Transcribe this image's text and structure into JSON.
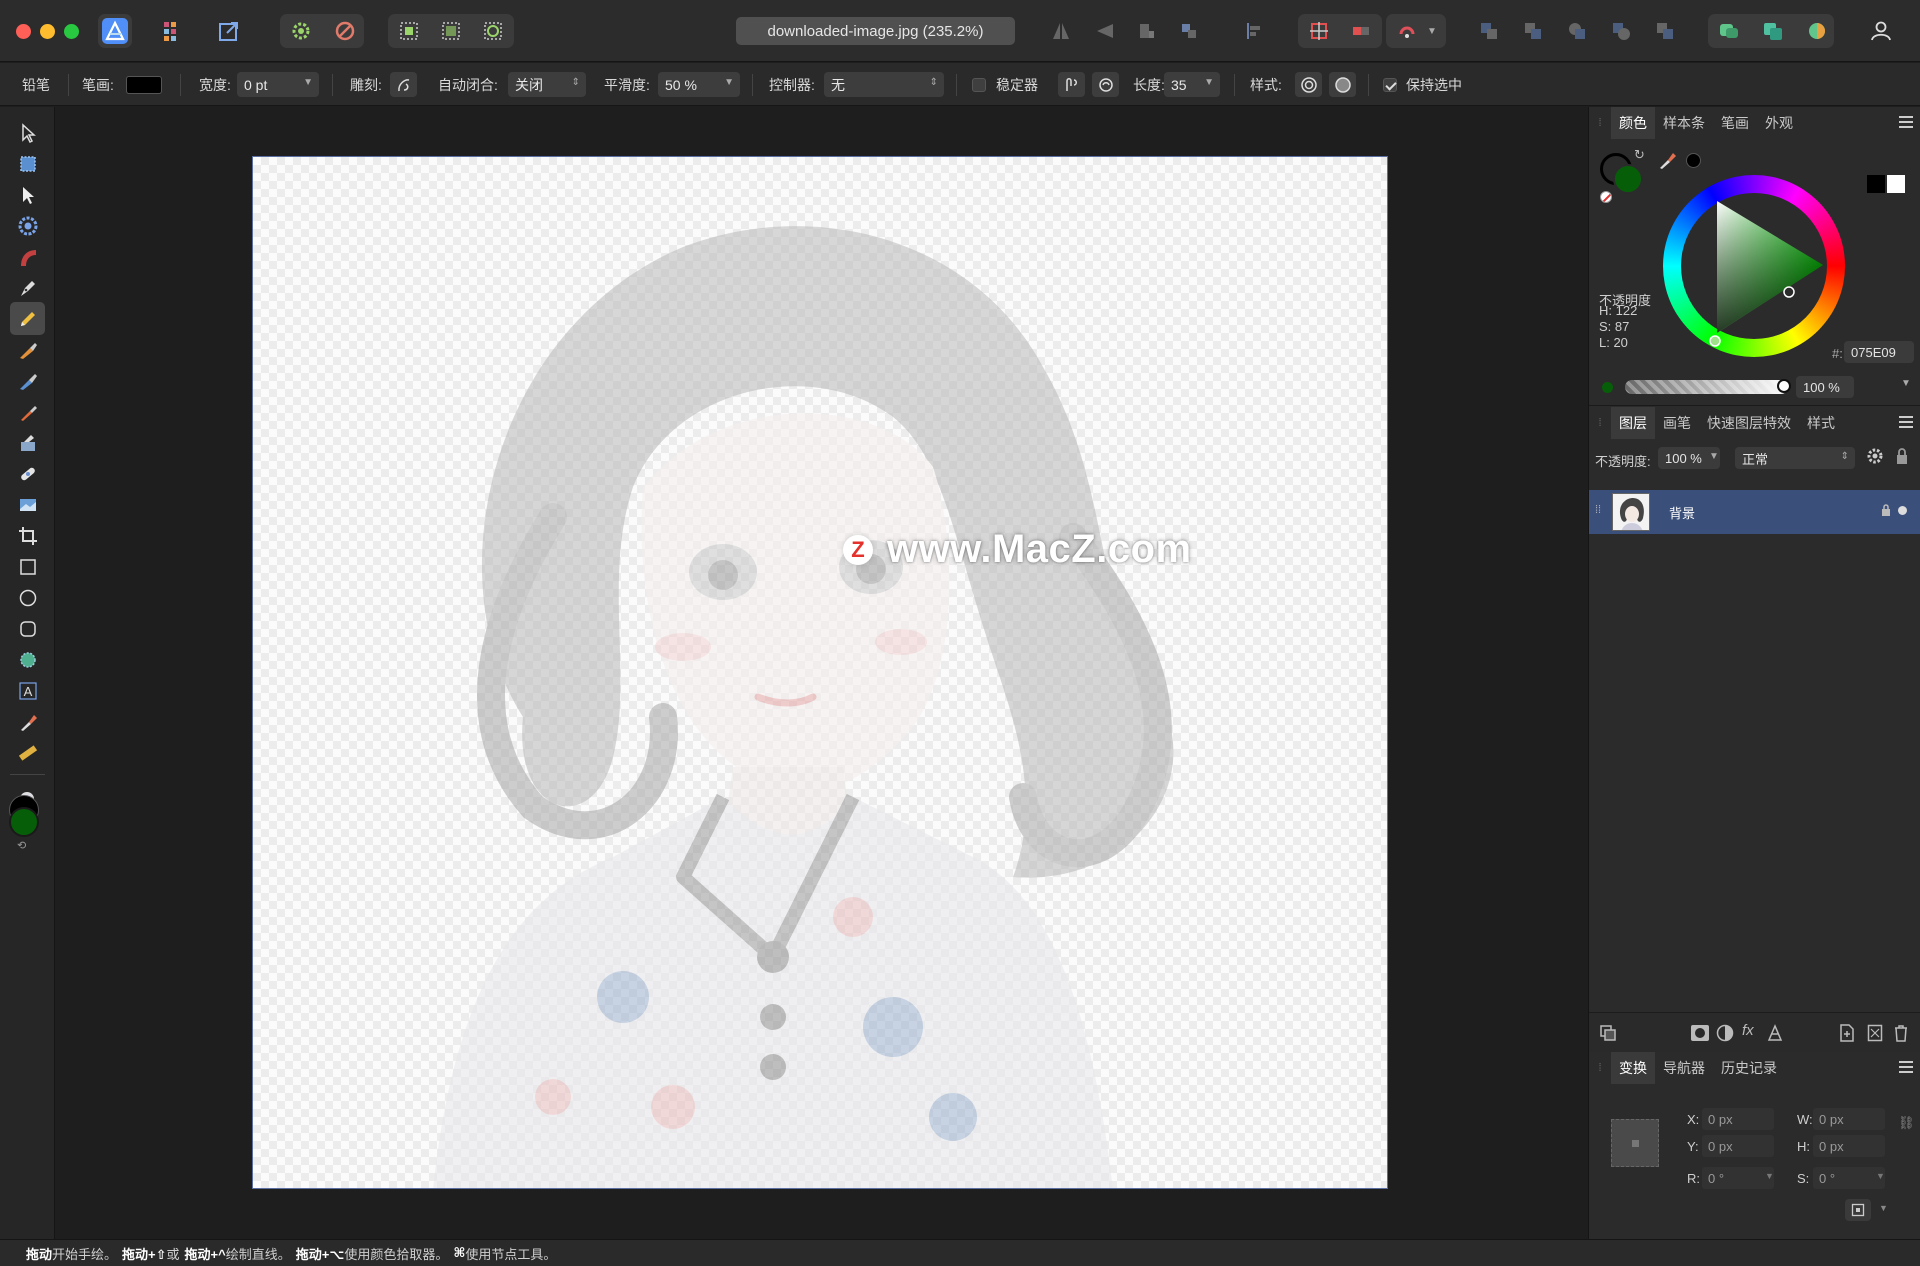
{
  "document": {
    "tab_title": "downloaded-image.jpg (235.2%)"
  },
  "context_toolbar": {
    "tool_name": "铅笔",
    "stroke_label": "笔画:",
    "width_label": "宽度:",
    "width_value": "0 pt",
    "sculpt_label": "雕刻:",
    "autoclose_label": "自动闭合:",
    "autoclose_value": "关闭",
    "smoothness_label": "平滑度:",
    "smoothness_value": "50 %",
    "controller_label": "控制器:",
    "controller_value": "无",
    "stabilizer_label": "稳定器",
    "length_label": "长度:",
    "length_value": "35",
    "style_label": "样式:",
    "keep_selected_label": "保持选中"
  },
  "colors": {
    "stroke_swatch": "#000000",
    "fill_color": "#075E09",
    "accent_blue": "#3a4f7a"
  },
  "color_panel": {
    "tabs": [
      "颜色",
      "样本条",
      "笔画",
      "外观"
    ],
    "h": "H: 122",
    "s": "S: 87",
    "l": "L: 20",
    "hex_label": "#:",
    "hex_value": "075E09",
    "opacity_label": "不透明度",
    "opacity_value": "100 %"
  },
  "layers_panel": {
    "tabs": [
      "图层",
      "画笔",
      "快速图层特效",
      "样式"
    ],
    "opacity_label": "不透明度:",
    "opacity_value": "100 %",
    "blend_mode": "正常",
    "layers": [
      {
        "name": "背景"
      }
    ]
  },
  "transform_panel": {
    "tabs": [
      "变换",
      "导航器",
      "历史记录"
    ],
    "x_label": "X:",
    "x_value": "0 px",
    "y_label": "Y:",
    "y_value": "0 px",
    "w_label": "W:",
    "w_value": "0 px",
    "h_label": "H:",
    "h_value": "0 px",
    "r_label": "R:",
    "r_value": "0 °",
    "s_label": "S:",
    "s_value": "0 °"
  },
  "canvas": {
    "watermark_letter": "Z",
    "watermark_text": "www.MacZ.com"
  },
  "status_bar": {
    "parts": [
      {
        "bold": "拖动",
        "text": "开始手绘。"
      },
      {
        "bold": "拖动+⇧",
        "text": "或"
      },
      {
        "bold": "拖动+^",
        "text": "绘制直线。"
      },
      {
        "bold": "拖动+⌥",
        "text": "使用颜色拾取器。"
      },
      {
        "bold": "⌘",
        "text": "使用节点工具。"
      }
    ]
  }
}
